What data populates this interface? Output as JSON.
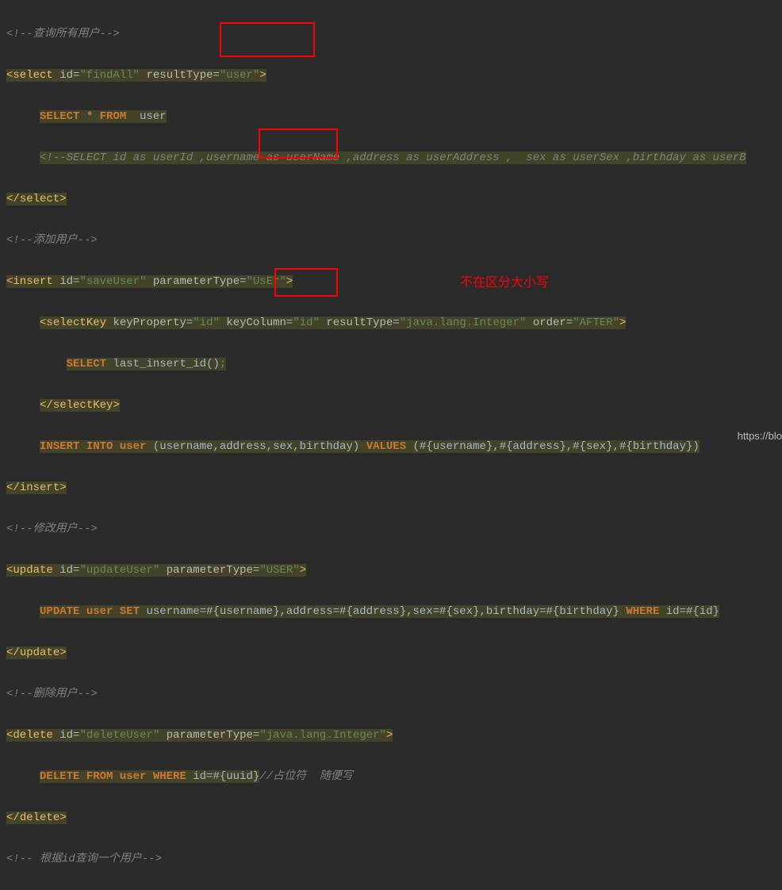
{
  "tokens": {
    "c_queryAll": "<!--查询所有用户-->",
    "t_select": "select",
    "a_id": "id",
    "v_findAll": "\"findAll\"",
    "a_resultType": "resultType",
    "v_user": "\"user\"",
    "kw_selectStarFrom": "SELECT * FROM  ",
    "txt_user": "user",
    "c_selectCols": "<!--SELECT id as userId ,username as userName ,address as userAddress ,  sex as userSex ,birthday as userB",
    "t_selectClose": "select",
    "c_addUser": "<!--添加用户-->",
    "t_insert": "insert",
    "v_saveUser": "\"saveUser\"",
    "a_parameterType": "parameterType",
    "v_UsEr": "\"UsEr\"",
    "t_selectKey": "selectKey",
    "a_keyProperty": "keyProperty",
    "v_id": "\"id\"",
    "a_keyColumn": "keyColumn",
    "v_id2": "\"id\"",
    "v_integer": "\"java.lang.Integer\"",
    "a_order": "order",
    "v_after": "\"AFTER\"",
    "kw_select": "SELECT",
    "txt_lastInsert": " last_insert_id()",
    "txt_semicolon": ";",
    "kw_insertInto": "INSERT INTO user ",
    "txt_cols": "(username,address,sex,birthday) ",
    "kw_values": "VALUES",
    "txt_placeholders": " (#{username},#{address},#{sex},#{birthday})",
    "c_updateUser": "<!--修改用户-->",
    "t_update": "update",
    "v_updateUser": "\"updateUser\"",
    "v_USER": "\"USER\"",
    "kw_update": "UPDATE user SET ",
    "txt_updateBody": "username=#{username},address=#{address},sex=#{sex},birthday=#{birthday} ",
    "kw_where": "WHERE",
    "txt_whereId": " id=#{id}",
    "c_deleteUser": "<!--删除用户-->",
    "t_delete": "delete",
    "v_deleteUser": "\"deleteUser\"",
    "kw_deleteFrom": "DELETE FROM user WHERE ",
    "txt_deleteBody": "id=#{uuid}",
    "c_placeholder": "//占位符  随便写",
    "c_queryById": "<!-- 根据id查询一个用户-->"
  },
  "annotation": "不在区分大小写",
  "watermark": "https://blo"
}
